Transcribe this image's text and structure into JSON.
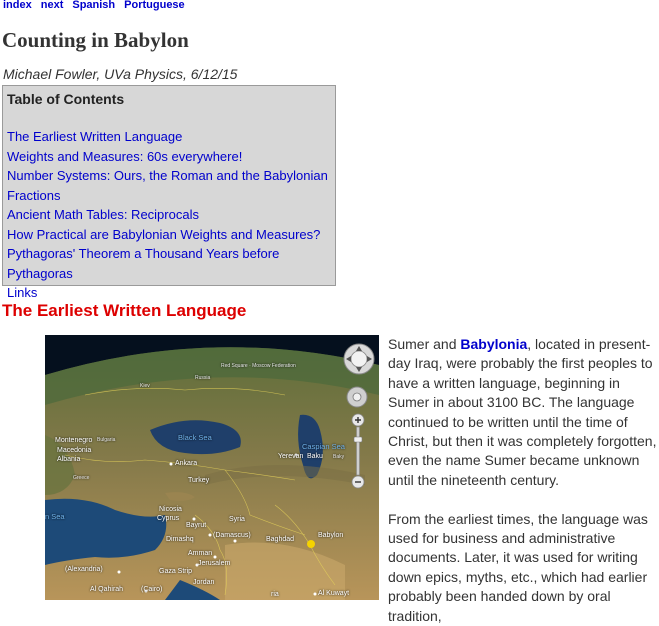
{
  "topnav": {
    "links": [
      "index",
      "next",
      "Spanish",
      "Portuguese"
    ]
  },
  "page": {
    "title": "Counting in Babylon",
    "byline": "Michael Fowler, UVa Physics, 6/12/15"
  },
  "toc": {
    "heading": "Table of Contents",
    "items": [
      "The Earliest Written Language",
      "Weights and Measures: 60s everywhere!",
      "Number Systems: Ours, the Roman and the Babylonian Fractions",
      "Ancient Math Tables: Reciprocals",
      "How Practical are Babylonian Weights and Measures?",
      "Pythagoras' Theorem a Thousand Years before Pythagoras",
      "Links"
    ]
  },
  "section": {
    "heading": "The Earliest Written Language"
  },
  "map": {
    "labels": {
      "black_sea": "Black Sea",
      "caspian_sea": "Caspian Sea",
      "turkey": "Turkey",
      "syria": "Syria",
      "ankara": "Ankara",
      "nicosia": "Nicosia",
      "cyprus": "Cyprus",
      "bayrut": "Bayrut",
      "dimashq": "Dimashq",
      "damascus": "(Damascus)",
      "baghdad": "Baghdad",
      "babylon": "Babylon",
      "amman": "Amman",
      "jerusalem": "Jerusalem",
      "gaza_strip": "Gaza Strip",
      "alexandria": "(Alexandria)",
      "jordan": "Jordan",
      "al_qahirah": "Al Qahirah",
      "cairo": "(Cairo)",
      "al_kuwayt": "Al Kuwayt",
      "yerevan": "Yerevan",
      "baku": "Baku",
      "montenegro": "Montenegro",
      "albania": "Albania",
      "macedonia": "Macedonia",
      "sea_fragment": "n Sea",
      "russia": "Russia",
      "kiev": "Kiev",
      "bulgaria": "Bulgaria",
      "greece": "Greece",
      "federation": "Red Square · Moscow Federation",
      "baky": "Baky",
      "ria": "ria"
    }
  },
  "article": {
    "p1_before": "Sumer and ",
    "p1_link": "Babylonia",
    "p1_after": ", located in present-day Iraq, were probably the first peoples to have a written language, beginning in Sumer in about 3100 BC.  The language continued to be written until the time of Christ, but then it was completely forgotten, even the name Sumer became unknown until the nineteenth century.",
    "p2": "From the earliest times, the language was used for business and administrative documents.  Later, it was used for writing down epics, myths, etc., which had earlier probably been handed down by oral tradition,"
  }
}
